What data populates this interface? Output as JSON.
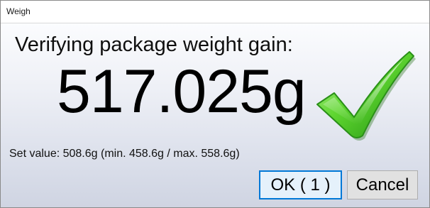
{
  "window": {
    "title": "Weigh"
  },
  "main": {
    "heading": "Verifying package weight gain:",
    "weight_value": "517.025g",
    "set_value_text": "Set value: 508.6g (min. 458.6g / max. 558.6g)",
    "status_icon": "check-icon",
    "status_color": "#3fbf1f"
  },
  "buttons": {
    "ok_label": "OK ( 1 )",
    "cancel_label": "Cancel"
  }
}
